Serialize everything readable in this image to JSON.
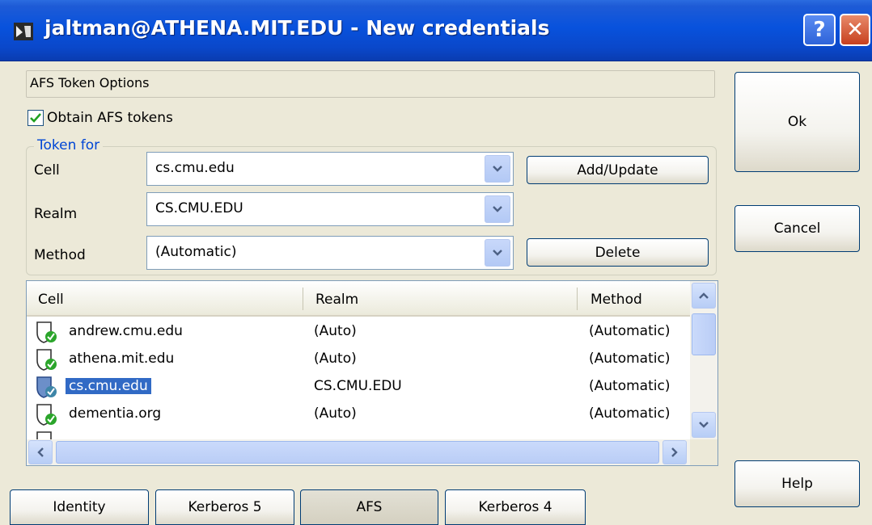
{
  "window": {
    "title": "jaltman@ATHENA.MIT.EDU - New credentials",
    "help_glyph": "?",
    "close_glyph": "✕"
  },
  "afs": {
    "section_title": "AFS Token Options",
    "obtain_tokens_label": "Obtain AFS tokens",
    "obtain_tokens_checked": true
  },
  "token_for": {
    "legend": "Token for",
    "cell_label": "Cell",
    "cell_value": "cs.cmu.edu",
    "realm_label": "Realm",
    "realm_value": "CS.CMU.EDU",
    "method_label": "Method",
    "method_value": "(Automatic)",
    "add_update_label": "Add/Update",
    "delete_label": "Delete"
  },
  "token_list": {
    "columns": [
      "Cell",
      "Realm",
      "Method"
    ],
    "rows": [
      {
        "cell": "andrew.cmu.edu",
        "realm": "(Auto)",
        "method": "(Automatic)",
        "selected": false
      },
      {
        "cell": "athena.mit.edu",
        "realm": "(Auto)",
        "method": "(Automatic)",
        "selected": false
      },
      {
        "cell": "cs.cmu.edu",
        "realm": "CS.CMU.EDU",
        "method": "(Automatic)",
        "selected": true
      },
      {
        "cell": "dementia.org",
        "realm": "(Auto)",
        "method": "(Automatic)",
        "selected": false
      },
      {
        "cell": "",
        "realm": "",
        "method": "",
        "selected": false
      }
    ]
  },
  "buttons": {
    "ok": "Ok",
    "cancel": "Cancel",
    "help": "Help"
  },
  "tabs": [
    {
      "label": "Identity",
      "active": false
    },
    {
      "label": "Kerberos 5",
      "active": false
    },
    {
      "label": "AFS",
      "active": true
    },
    {
      "label": "Kerberos 4",
      "active": false
    }
  ],
  "colors": {
    "titlebar": "#0A47C9",
    "selection": "#316AC5",
    "legend_text": "#0046D5",
    "window_bg": "#ECE9D8"
  },
  "icons": {
    "title": "credentials-app-icon",
    "row": "afs-token-shield-icon"
  }
}
